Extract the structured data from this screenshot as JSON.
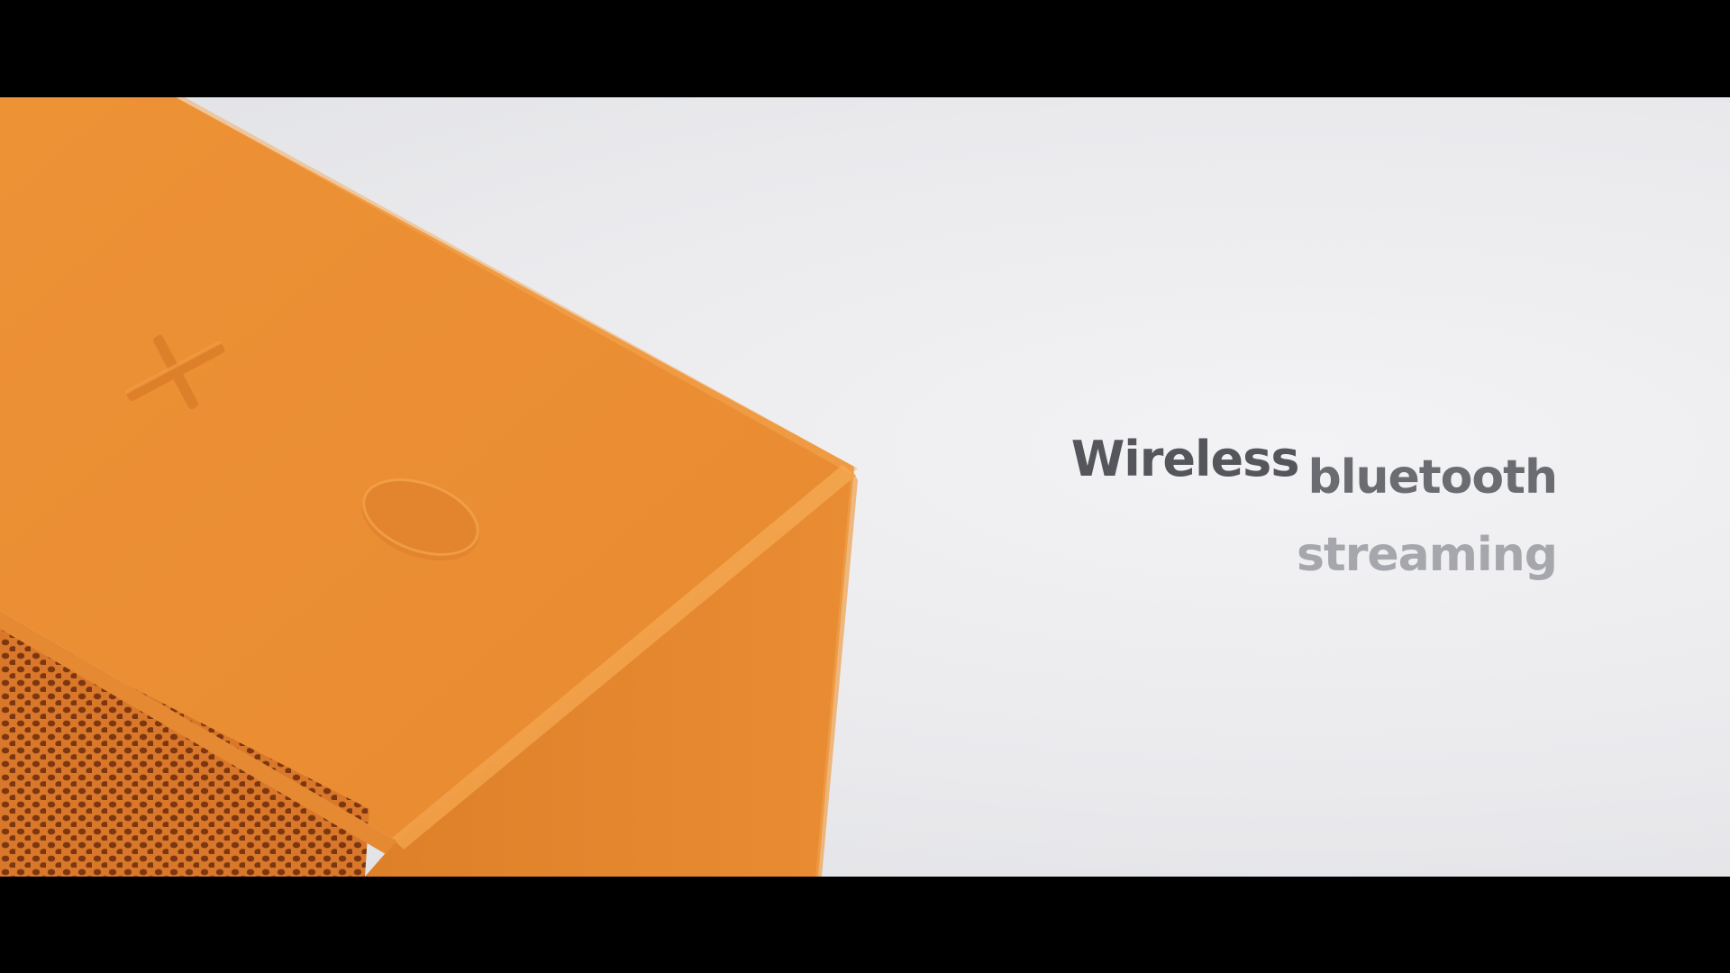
{
  "caption": {
    "line1_word1": "Wireless",
    "line1_word2": "bluetooth",
    "line2": "streaming"
  },
  "colors": {
    "letterbox": "#000000",
    "background": "#eaeaed",
    "speaker_orange": "#ea8f34",
    "speaker_front_orange": "#e5892f",
    "grille_dark": "#8a3e10",
    "text_dark": "#54565c",
    "text_mid": "#6a6c72",
    "text_light": "#a5a7ac"
  },
  "icons": {
    "button_plus": "plus-icon",
    "button_round": "power-button-icon"
  }
}
